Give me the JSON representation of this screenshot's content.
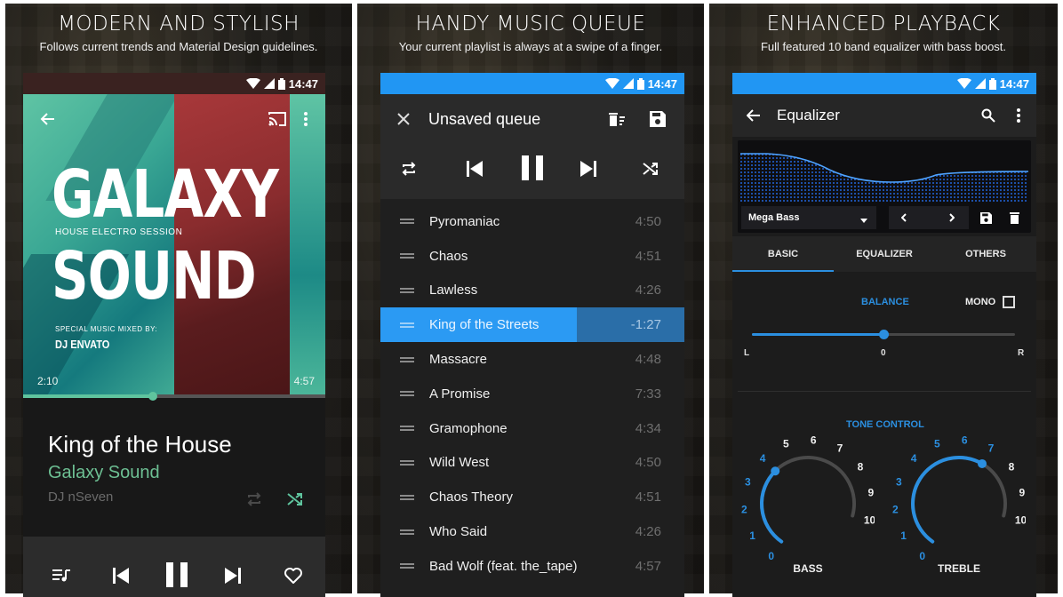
{
  "panels": [
    {
      "title": "MODERN AND STYLISH",
      "subtitle": "Follows current trends and Material Design guidelines.",
      "status_time": "14:47",
      "album_art": {
        "line1": "GALAXY",
        "tagline": "HOUSE ELECTRO SESSION",
        "line2": "SOUND",
        "credit_label": "SPECIAL MUSIC MIXED BY:",
        "credit_name": "DJ ENVATO"
      },
      "elapsed": "2:10",
      "duration": "4:57",
      "progress_fraction": 0.43,
      "track_title": "King of the House",
      "album": "Galaxy Sound",
      "artist": "DJ nSeven",
      "accent_color": "#5fc49e",
      "icons": [
        "back-arrow-icon",
        "cast-icon",
        "more-vert-icon",
        "repeat-icon",
        "shuffle-icon",
        "queue-music-icon",
        "skip-previous-icon",
        "pause-icon",
        "skip-next-icon",
        "heart-icon"
      ]
    },
    {
      "title": "HANDY MUSIC QUEUE",
      "subtitle": "Your current playlist is always at a swipe of a finger.",
      "status_time": "14:47",
      "toolbar_title": "Unsaved queue",
      "accent_color": "#2196f3",
      "queue": [
        {
          "name": "Pyromaniac",
          "duration": "4:50"
        },
        {
          "name": "Chaos",
          "duration": "4:51"
        },
        {
          "name": "Lawless",
          "duration": "4:26"
        },
        {
          "name": "King of the Streets",
          "duration": "-1:27",
          "active": true
        },
        {
          "name": "Massacre",
          "duration": "4:48"
        },
        {
          "name": "A Promise",
          "duration": "7:33"
        },
        {
          "name": "Gramophone",
          "duration": "4:34"
        },
        {
          "name": "Wild West",
          "duration": "4:50"
        },
        {
          "name": "Chaos Theory",
          "duration": "4:51"
        },
        {
          "name": "Who Said",
          "duration": "4:26"
        },
        {
          "name": "Bad Wolf (feat. the_tape)",
          "duration": "4:57"
        }
      ]
    },
    {
      "title": "ENHANCED PLAYBACK",
      "subtitle": "Full featured 10 band equalizer with bass boost.",
      "status_time": "14:47",
      "toolbar_title": "Equalizer",
      "preset": "Mega Bass",
      "tabs": [
        "BASIC",
        "EQUALIZER",
        "OTHERS"
      ],
      "active_tab": "BASIC",
      "balance_label": "BALANCE",
      "mono_label": "MONO",
      "mono_checked": false,
      "balance_left": "L",
      "balance_center": "0",
      "balance_right": "R",
      "balance_fraction": 0.5,
      "tone_label": "TONE CONTROL",
      "bass_label": "BASS",
      "bass_value": 4,
      "treble_label": "TREBLE",
      "treble_value": 7,
      "knob_ticks": [
        "0",
        "1",
        "2",
        "3",
        "4",
        "5",
        "6",
        "7",
        "8",
        "9",
        "10"
      ],
      "accent_color": "#2b8fe0"
    }
  ]
}
